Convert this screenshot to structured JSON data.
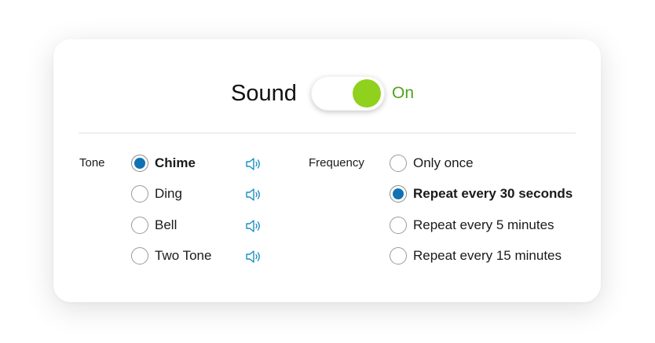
{
  "sound": {
    "title": "Sound",
    "state_label": "On",
    "enabled": true
  },
  "tone": {
    "label": "Tone",
    "selected": "Chime",
    "options": [
      {
        "label": "Chime",
        "checked": true,
        "icon": "speaker-icon"
      },
      {
        "label": "Ding",
        "checked": false,
        "icon": "speaker-icon"
      },
      {
        "label": "Bell",
        "checked": false,
        "icon": "speaker-icon"
      },
      {
        "label": "Two Tone",
        "checked": false,
        "icon": "speaker-icon"
      }
    ]
  },
  "frequency": {
    "label": "Frequency",
    "selected": "Repeat every 30 seconds",
    "options": [
      {
        "label": "Only once",
        "checked": false
      },
      {
        "label": "Repeat every 30 seconds",
        "checked": true
      },
      {
        "label": "Repeat every 5 minutes",
        "checked": false
      },
      {
        "label": "Repeat every 15 minutes",
        "checked": false
      }
    ]
  },
  "colors": {
    "toggle_on": "#8fd11c",
    "on_text": "#4fa31a",
    "radio_selected": "#1072b3",
    "speaker_icon": "#1a8fc4"
  }
}
